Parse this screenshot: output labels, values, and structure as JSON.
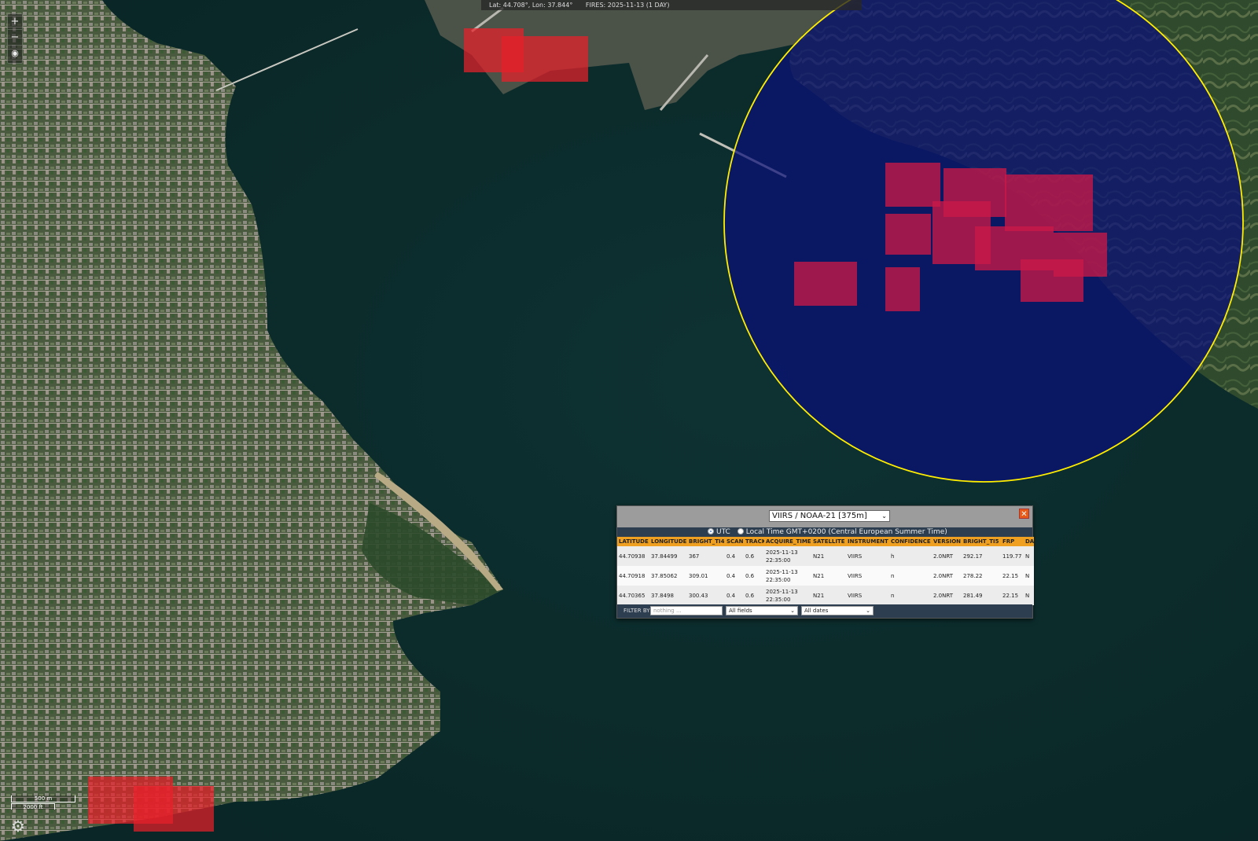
{
  "topbar": {
    "coords": "Lat: 44.708°, Lon: 37.844°",
    "fires": "FIRES: 2025-11-13 (1 DAY)"
  },
  "controls": {
    "zoom_in": "+",
    "zoom_out": "−",
    "locate_icon": "pin-icon"
  },
  "scalebar": {
    "top_label": "500 m",
    "bottom_label": "2000 ft"
  },
  "popup": {
    "source_select": "VIIRS / NOAA-21 [375m]",
    "close_label": "✕",
    "tz_utc": "UTC",
    "tz_local": "Local Time GMT+0200 (Central European Summer Time)",
    "columns": [
      "LATITUDE",
      "LONGITUDE",
      "BRIGHT_TI4",
      "SCAN",
      "TRACK",
      "ACQUIRE_TIME",
      "SATELLITE",
      "INSTRUMENT",
      "CONFIDENCE",
      "VERSION",
      "BRIGHT_TI5",
      "FRP",
      "DA"
    ],
    "rows": [
      [
        "44.70938",
        "37.84499",
        "367",
        "0.4",
        "0.6",
        "2025-11-13 22:35:00",
        "N21",
        "VIIRS",
        "h",
        "2.0NRT",
        "292.17",
        "119.77",
        "N"
      ],
      [
        "44.70918",
        "37.85062",
        "309.01",
        "0.4",
        "0.6",
        "2025-11-13 22:35:00",
        "N21",
        "VIIRS",
        "n",
        "2.0NRT",
        "278.22",
        "22.15",
        "N"
      ],
      [
        "44.70365",
        "37.8498",
        "300.43",
        "0.4",
        "0.6",
        "2025-11-13 22:35:00",
        "N21",
        "VIIRS",
        "n",
        "2.0NRT",
        "281.49",
        "22.15",
        "N"
      ]
    ],
    "filter": {
      "label": "FILTER BY",
      "placeholder": "nothing ...",
      "fields": "All fields",
      "dates": "All dates"
    }
  },
  "colors": {
    "fire_detection": "#e8202a",
    "selection_fill": "#0a0f78",
    "selection_ring": "#ffee00",
    "header_orange": "#f0a020"
  }
}
